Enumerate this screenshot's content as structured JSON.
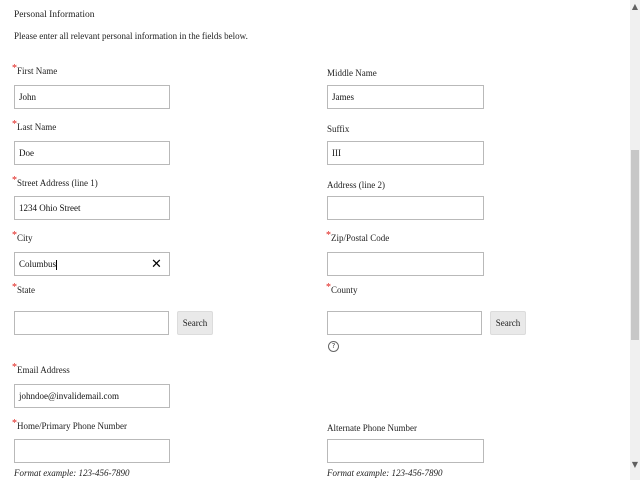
{
  "form": {
    "section_title": "Personal Information",
    "intro": "Please enter all relevant personal information in the fields below.",
    "required_mark": "*",
    "first_name": {
      "label": "First Name",
      "value": "John"
    },
    "middle_name": {
      "label": "Middle Name",
      "value": "James"
    },
    "last_name": {
      "label": "Last Name",
      "value": "Doe"
    },
    "suffix": {
      "label": "Suffix",
      "value": "III"
    },
    "street1": {
      "label": "Street Address (line 1)",
      "value": "1234 Ohio Street"
    },
    "street2": {
      "label": "Address (line 2)",
      "value": ""
    },
    "city": {
      "label": "City",
      "value": "Columbus"
    },
    "zip": {
      "label": "Zip/Postal Code",
      "value": ""
    },
    "state": {
      "label": "State",
      "value": "",
      "search_label": "Search"
    },
    "county": {
      "label": "County",
      "value": "",
      "search_label": "Search"
    },
    "email": {
      "label": "Email Address",
      "value": "johndoe@invalidemail.com"
    },
    "home_phone": {
      "label": "Home/Primary Phone Number",
      "value": "",
      "format": "Format example:  123-456-7890"
    },
    "alt_phone": {
      "label": "Alternate Phone Number",
      "value": "",
      "format": "Format example:  123-456-7890"
    }
  },
  "icons": {
    "clear": "✕",
    "help": "?",
    "scroll_up": "▲",
    "scroll_down": "▼"
  }
}
